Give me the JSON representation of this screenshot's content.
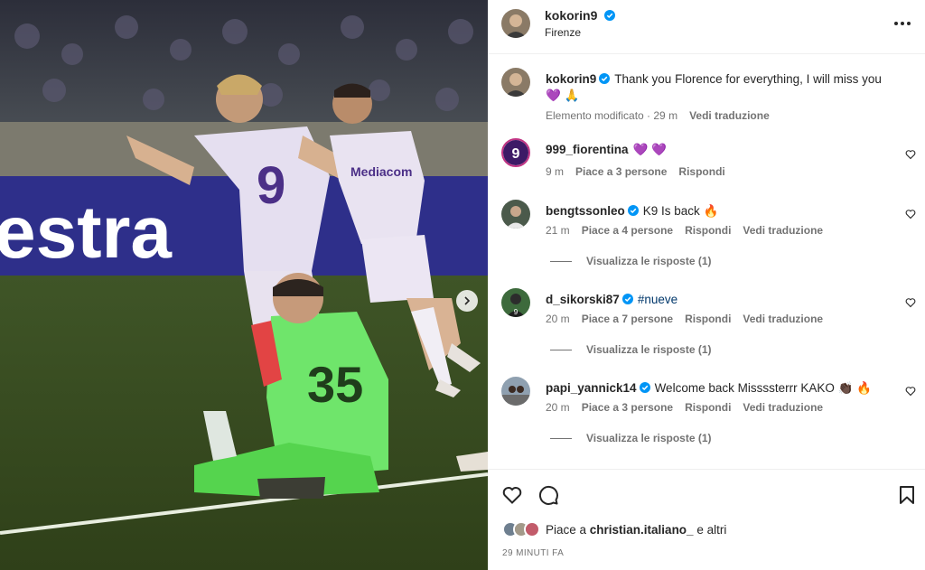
{
  "post": {
    "username": "kokorin9",
    "location": "Firenze",
    "verified_color": "#0095f6",
    "photo": {
      "banner_text": "estra",
      "player_shirt_number": "9",
      "sponsor_text": "Mediacom",
      "keeper_shirt_number": "35",
      "next_icon": "chevron-right-icon"
    }
  },
  "caption": {
    "username": "kokorin9",
    "text": "Thank you Florence for everything, I will miss you 💜 🙏",
    "edited": "Elemento modificato · 29 m",
    "translate": "Vedi traduzione"
  },
  "comments": [
    {
      "username": "999_fiorentina",
      "text": "💜 💜",
      "time": "9 m",
      "likes": "Piace a 3 persone",
      "reply": "Rispondi",
      "translate": "",
      "verified": false,
      "view_replies": ""
    },
    {
      "username": "bengtssonleo",
      "text": "K9 Is back 🔥",
      "time": "21 m",
      "likes": "Piace a 4 persone",
      "reply": "Rispondi",
      "translate": "Vedi traduzione",
      "verified": true,
      "view_replies": "Visualizza le risposte (1)"
    },
    {
      "username": "d_sikorski87",
      "text": "#nueve",
      "time": "20 m",
      "likes": "Piace a 7 persone",
      "reply": "Rispondi",
      "translate": "Vedi traduzione",
      "verified": true,
      "view_replies": "Visualizza le risposte (1)"
    },
    {
      "username": "papi_yannick14",
      "text": "Welcome back Missssterrr KAKO 👏🏿 🔥",
      "time": "20 m",
      "likes": "Piace a 3 persone",
      "reply": "Rispondi",
      "translate": "Vedi traduzione",
      "verified": true,
      "view_replies": "Visualizza le risposte (1)"
    }
  ],
  "actions": {
    "like_icon": "heart-icon",
    "comment_icon": "comment-icon",
    "save_icon": "bookmark-icon"
  },
  "likes": {
    "prefix": "Piace a ",
    "user": "christian.italiano_",
    "suffix": " e altri"
  },
  "timestamp": "29 MINUTI FA"
}
